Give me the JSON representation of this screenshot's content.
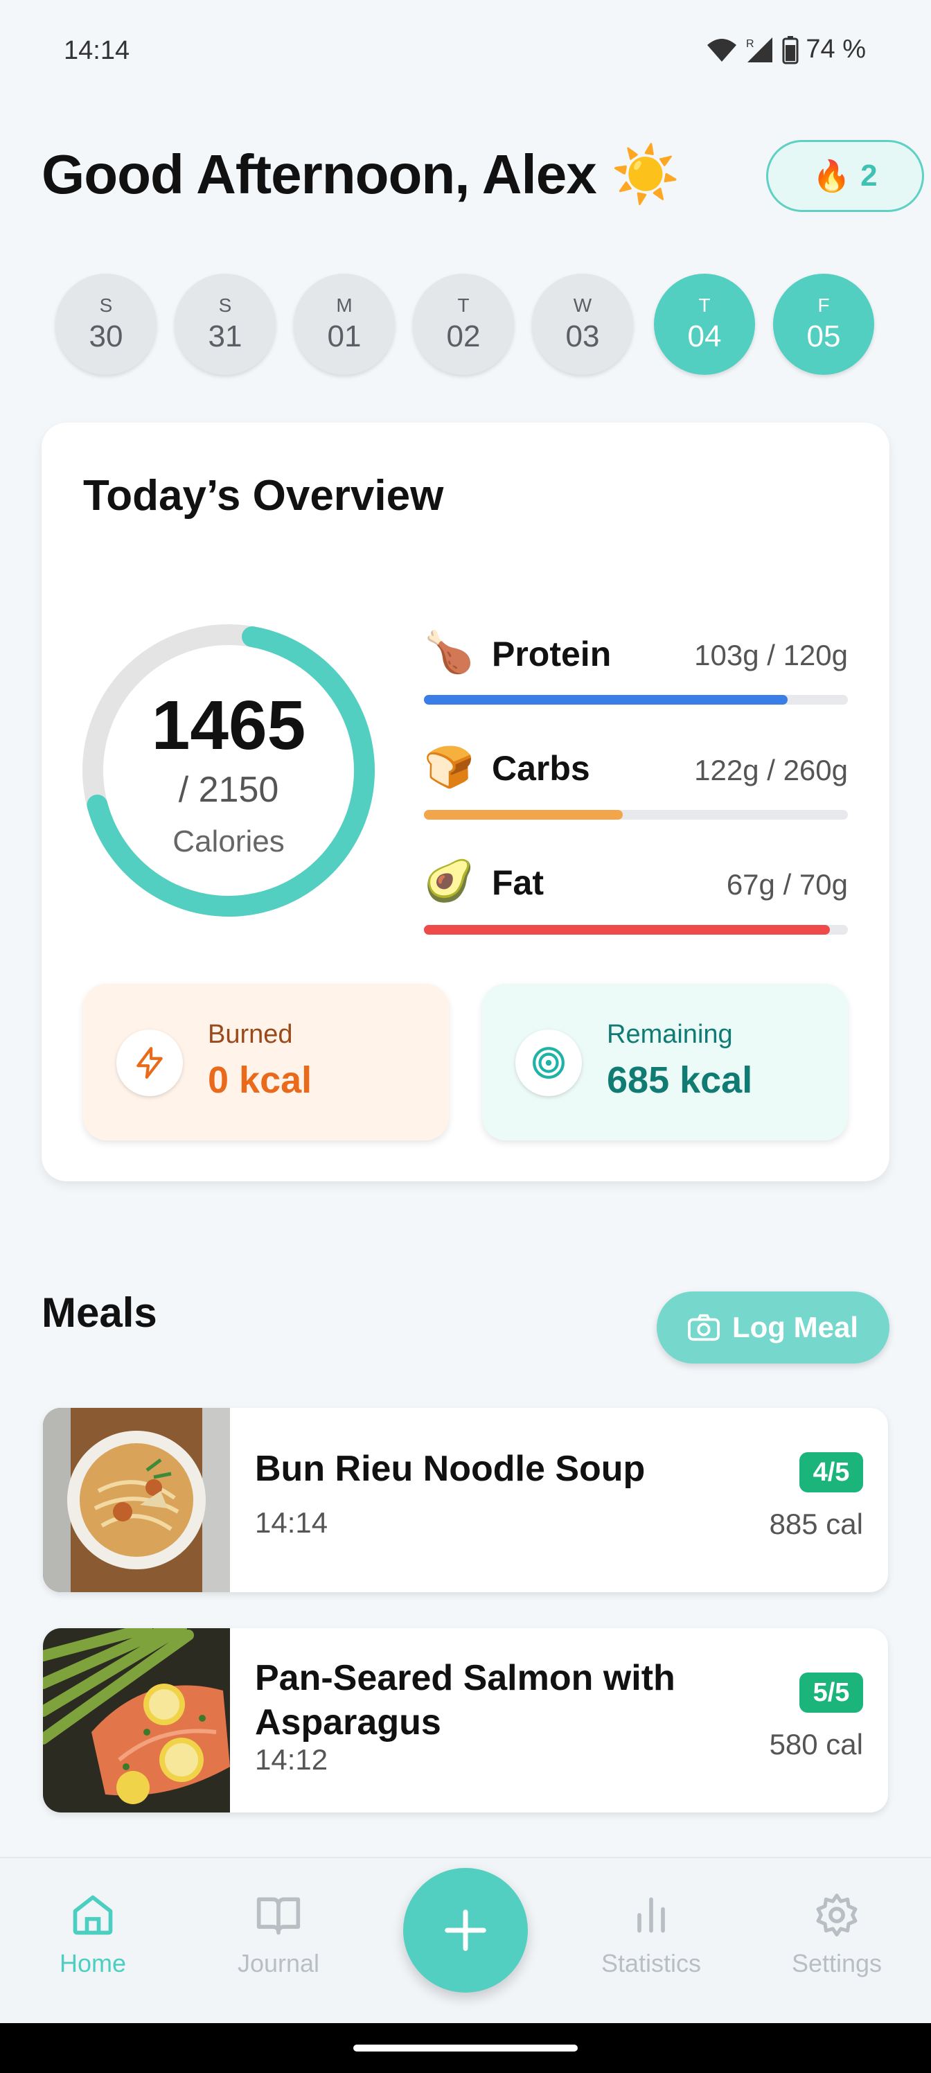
{
  "status": {
    "time": "14:14",
    "battery": "74 %"
  },
  "header": {
    "greeting": "Good Afternoon, Alex",
    "greeting_emoji": "☀️",
    "streak": "2"
  },
  "days": [
    {
      "letter": "S",
      "num": "30",
      "active": false
    },
    {
      "letter": "S",
      "num": "31",
      "active": false
    },
    {
      "letter": "M",
      "num": "01",
      "active": false
    },
    {
      "letter": "T",
      "num": "02",
      "active": false
    },
    {
      "letter": "W",
      "num": "03",
      "active": false
    },
    {
      "letter": "T",
      "num": "04",
      "active": true
    },
    {
      "letter": "F",
      "num": "05",
      "active": true
    }
  ],
  "overview": {
    "title": "Today’s Overview",
    "calories": "1465",
    "goal": "/ 2150",
    "label": "Calories",
    "progress": 0.681,
    "macros": [
      {
        "name": "Protein",
        "value": "103g / 120g",
        "progress": 0.858,
        "color": "#3b7de6",
        "emoji": "🍗"
      },
      {
        "name": "Carbs",
        "value": "122g / 260g",
        "progress": 0.469,
        "color": "#f2a54a",
        "emoji": "🍞"
      },
      {
        "name": "Fat",
        "value": "67g / 70g",
        "progress": 0.957,
        "color": "#ee4a4a",
        "emoji": "🥑"
      }
    ],
    "burned": {
      "label": "Burned",
      "value": "0 kcal"
    },
    "remaining": {
      "label": "Remaining",
      "value": "685 kcal"
    }
  },
  "meals": {
    "title": "Meals",
    "log_button": "Log Meal",
    "items": [
      {
        "name": "Bun Rieu Noodle Soup",
        "time": "14:14",
        "rating": "4/5",
        "calories": "885 cal"
      },
      {
        "name": "Pan-Seared Salmon with Asparagus",
        "time": "14:12",
        "rating": "5/5",
        "calories": "580 cal"
      }
    ]
  },
  "nav": {
    "home": "Home",
    "journal": "Journal",
    "statistics": "Statistics",
    "settings": "Settings"
  },
  "colors": {
    "accent": "#52cfc1",
    "burned": "#e86a1a",
    "remaining": "#0f7b73"
  }
}
